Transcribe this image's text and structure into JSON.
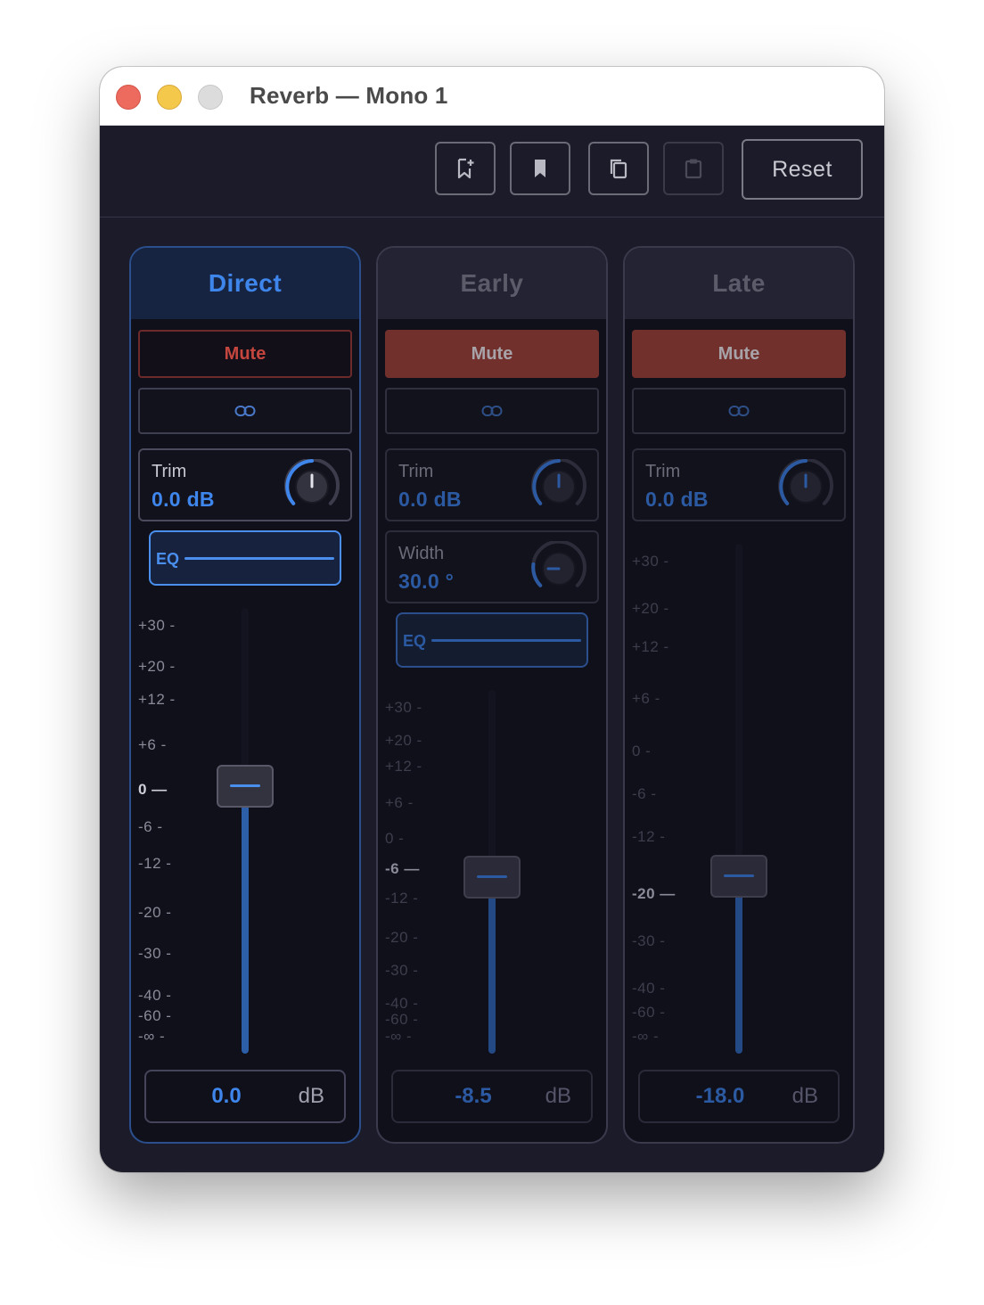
{
  "window": {
    "title": "Reverb — Mono 1"
  },
  "toolbar": {
    "buttons": [
      {
        "icon": "bookmark-add-icon",
        "enabled": true
      },
      {
        "icon": "bookmark-icon",
        "enabled": true
      },
      {
        "icon": "copy-icon",
        "enabled": true
      },
      {
        "icon": "paste-icon",
        "enabled": false
      }
    ],
    "reset_label": "Reset"
  },
  "strips": [
    {
      "name": "Direct",
      "active": true,
      "mute": {
        "label": "Mute",
        "engaged": false
      },
      "link_icon": "link-icon",
      "trim": {
        "label": "Trim",
        "value": "0.0 dB",
        "knob_fraction": 0.5
      },
      "eq_label": "EQ",
      "scale": [
        "+30",
        "+20",
        "+12",
        "+6",
        "0",
        "-6",
        "-12",
        "-20",
        "-30",
        "-40",
        "-60",
        "-∞"
      ],
      "scale_selected": "0",
      "fader": {
        "value": "0.0",
        "unit": "dB"
      }
    },
    {
      "name": "Early",
      "active": false,
      "mute": {
        "label": "Mute",
        "engaged": true
      },
      "link_icon": "link-icon",
      "trim": {
        "label": "Trim",
        "value": "0.0 dB",
        "knob_fraction": 0.5
      },
      "width": {
        "label": "Width",
        "value": "30.0 °",
        "knob_fraction": 0.17
      },
      "eq_label": "EQ",
      "scale": [
        "+30",
        "+20",
        "+12",
        "+6",
        "0",
        "-6",
        "-12",
        "-20",
        "-30",
        "-40",
        "-60",
        "-∞"
      ],
      "scale_selected": "-6",
      "fader": {
        "value": "-8.5",
        "unit": "dB"
      }
    },
    {
      "name": "Late",
      "active": false,
      "mute": {
        "label": "Mute",
        "engaged": true
      },
      "link_icon": "link-icon",
      "trim": {
        "label": "Trim",
        "value": "0.0 dB",
        "knob_fraction": 0.5
      },
      "scale": [
        "+30",
        "+20",
        "+12",
        "+6",
        "0",
        "-6",
        "-12",
        "-20",
        "-30",
        "-40",
        "-60",
        "-∞"
      ],
      "scale_selected": "-20",
      "fader": {
        "value": "-18.0",
        "unit": "dB"
      }
    }
  ]
}
